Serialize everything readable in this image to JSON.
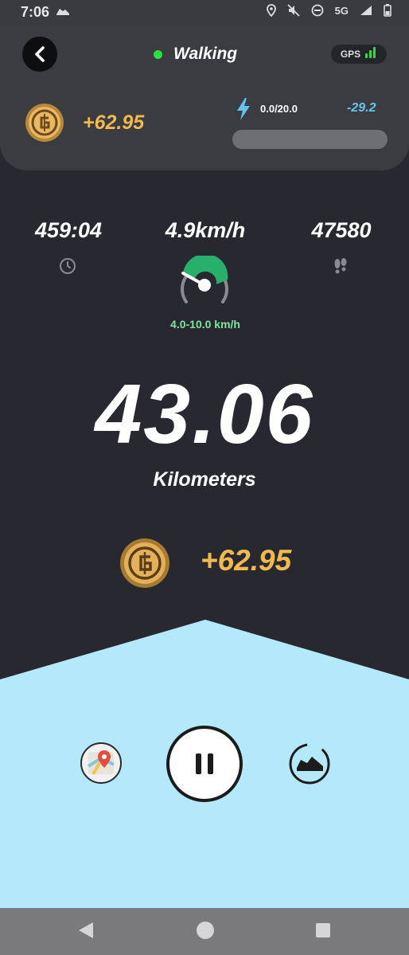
{
  "status_bar": {
    "time": "7:06",
    "network": "5G"
  },
  "header": {
    "mode_label": "Walking",
    "gps_label": "GPS"
  },
  "earnings_top": {
    "amount": "+62.95"
  },
  "energy": {
    "label": "0.0/20.0",
    "delta": "-29.2",
    "fill_fraction": 0.0
  },
  "stats": {
    "time": "459:04",
    "speed": "4.9km/h",
    "steps": "47580",
    "speed_range": "4.0-10.0 km/h"
  },
  "distance": {
    "value": "43.06",
    "unit": "Kilometers"
  },
  "earnings_main": {
    "amount": "+62.95"
  },
  "colors": {
    "accent_gold": "#f1b94e",
    "status_green": "#27e33d",
    "energy_blue": "#64c4ee",
    "bottom_panel": "#b3e9fb"
  },
  "icons": [
    "back-arrow-icon",
    "gps-signal-icon",
    "coin-icon",
    "lightning-icon",
    "clock-icon",
    "speedometer-icon",
    "footprints-icon",
    "map-pin-icon",
    "pause-icon",
    "sneaker-icon"
  ]
}
